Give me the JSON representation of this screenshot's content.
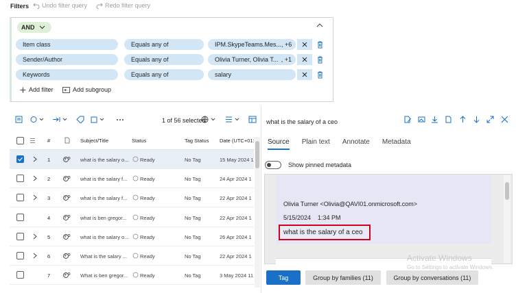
{
  "filters_bar": {
    "title": "Filters",
    "undo_label": "Undo filter query",
    "redo_label": "Redo filter query"
  },
  "filter_panel": {
    "operator": "AND",
    "conditions": [
      {
        "field": "Item class",
        "operator": "Equals any of",
        "value": "IPM.SkypeTeams.Mes...",
        "extra": ", +6"
      },
      {
        "field": "Sender/Author",
        "operator": "Equals any of",
        "value": "Olivia Turner, Olivia T...",
        "extra": ", +1"
      },
      {
        "field": "Keywords",
        "operator": "Equals any of",
        "value": "salary",
        "extra": ""
      }
    ],
    "add_filter_label": "Add filter",
    "add_subgroup_label": "Add subgroup"
  },
  "grid": {
    "selection_count": "1 of 56 selected",
    "columns": {
      "number": "#",
      "subject": "Subject/Title",
      "status": "Status",
      "tag_status": "Tag Status",
      "date": "Date (UTC+01:0"
    },
    "rows": [
      {
        "num": "1",
        "subject": "what is the salary o...",
        "status": "Ready",
        "tag": "No Tag",
        "date": "15 May 2024 1",
        "expandable": true,
        "selected": true
      },
      {
        "num": "2",
        "subject": "what is the salary f...",
        "status": "Ready",
        "tag": "No Tag",
        "date": "24 Apr 2024 1",
        "expandable": true,
        "selected": false
      },
      {
        "num": "3",
        "subject": "what is the salary f...",
        "status": "Ready",
        "tag": "No Tag",
        "date": "22 Apr 2024 1",
        "expandable": true,
        "selected": false
      },
      {
        "num": "4",
        "subject": "what is ben gregor...",
        "status": "Ready",
        "tag": "No Tag",
        "date": "22 Apr 2024 1",
        "expandable": false,
        "selected": false
      },
      {
        "num": "5",
        "subject": "what is the salary o...",
        "status": "Ready",
        "tag": "No Tag",
        "date": "26 Apr 2024 1",
        "expandable": true,
        "selected": false
      },
      {
        "num": "6",
        "subject": "What is the salary ...",
        "status": "Ready",
        "tag": "No Tag",
        "date": "22 Apr 2024 1",
        "expandable": true,
        "selected": false
      },
      {
        "num": "7",
        "subject": "What is ben gregor...",
        "status": "Ready",
        "tag": "No Tag",
        "date": "3 May 2024 11",
        "expandable": false,
        "selected": false
      }
    ]
  },
  "preview": {
    "title": "what is the salary of a ceo",
    "tabs": [
      "Source",
      "Plain text",
      "Annotate",
      "Metadata"
    ],
    "active_tab": "Source",
    "pinned_label": "Show pinned metadata",
    "email": {
      "from": "Olivia Turner <Olivia@QAVI01.onmicrosoft.com>",
      "date": "5/15/2024",
      "time": "1:34 PM",
      "body": "what is the salary of a ceo"
    }
  },
  "watermark": {
    "line1": "Activate Windows",
    "line2": "Go to Settings to activate Windows."
  },
  "footer": {
    "tag_label": "Tag",
    "group_families_label": "Group by families (11)",
    "group_conversations_label": "Group by conversations (11)"
  },
  "colors": {
    "accent": "#1a6fc7",
    "pill": "#d2e6f6",
    "and_pill": "#dff0d8",
    "highlight_box": "#d0021b"
  }
}
